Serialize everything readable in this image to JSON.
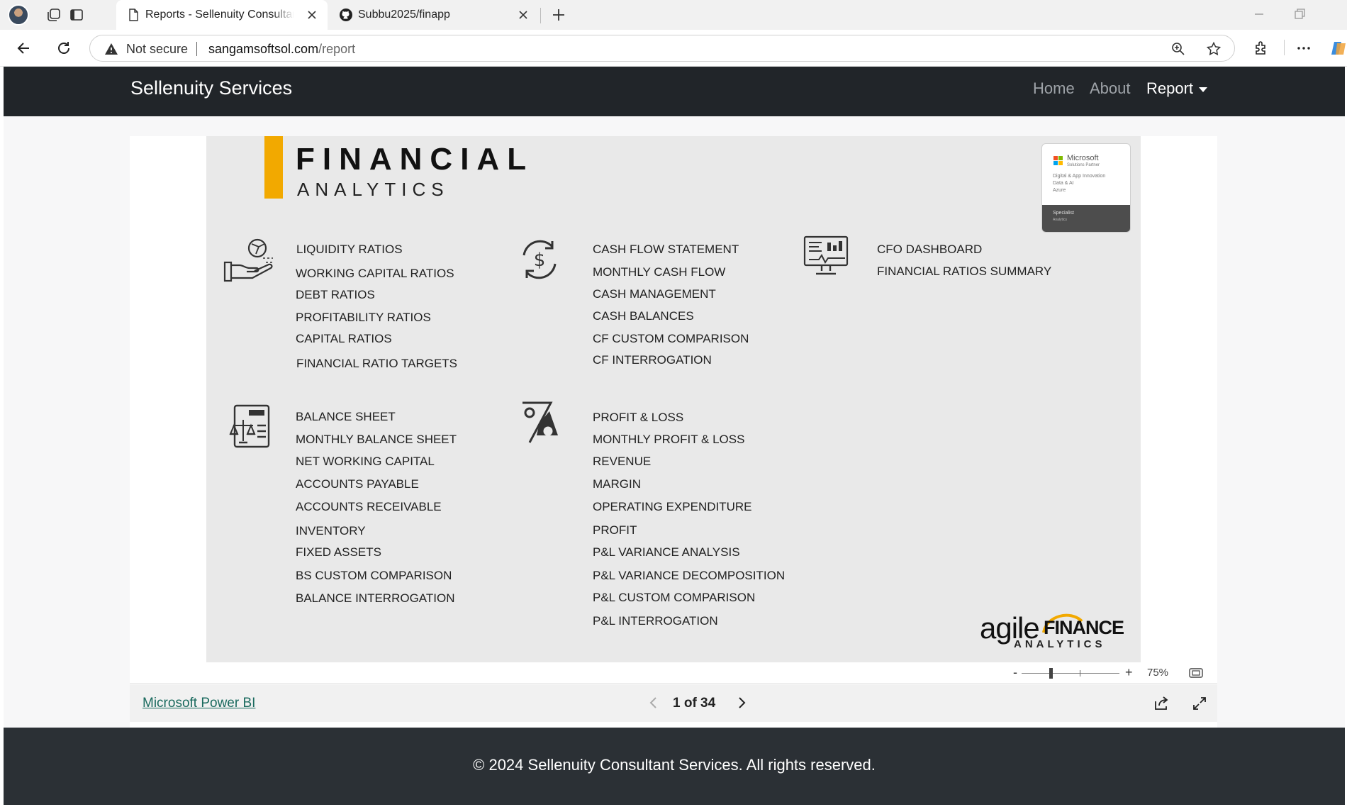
{
  "browser": {
    "tabs": [
      {
        "title": "Reports - Sellenuity Consultant Services",
        "active": true
      },
      {
        "title": "Subbu2025/finapp",
        "active": false
      }
    ],
    "security_label": "Not secure",
    "url_host": "sangamsoftsol.com",
    "url_path": "/report"
  },
  "site": {
    "brand": "Sellenuity Services",
    "nav": {
      "home": "Home",
      "about": "About",
      "report": "Report"
    },
    "footer": "© 2024 Sellenuity Consultant Services. All rights reserved."
  },
  "report": {
    "title": "FINANCIAL",
    "subtitle": "ANALYTICS",
    "badge": {
      "brand": "Microsoft",
      "partner": "Solutions Partner",
      "lines": [
        "Digital & App Innovation",
        "Data & AI",
        "Azure"
      ],
      "specialist": "Specialist",
      "specialist_area": "Analytics"
    },
    "groups": [
      {
        "icon": "hand-coin-icon",
        "items": [
          "LIQUIDITY RATIOS",
          "WORKING CAPITAL RATIOS",
          "DEBT RATIOS",
          "PROFITABILITY RATIOS",
          "CAPITAL RATIOS",
          "FINANCIAL RATIO TARGETS"
        ]
      },
      {
        "icon": "dollar-cycle-icon",
        "items": [
          "CASH FLOW STATEMENT",
          "MONTHLY CASH FLOW",
          "CASH MANAGEMENT",
          "CASH BALANCES",
          "CF CUSTOM COMPARISON",
          "CF INTERROGATION"
        ]
      },
      {
        "icon": "monitor-dashboard-icon",
        "items": [
          "CFO DASHBOARD",
          "FINANCIAL RATIOS SUMMARY"
        ]
      },
      {
        "icon": "balance-scale-doc-icon",
        "items": [
          "BALANCE SHEET",
          "MONTHLY BALANCE SHEET",
          "NET WORKING CAPITAL",
          "ACCOUNTS PAYABLE",
          "ACCOUNTS RECEIVABLE",
          "INVENTORY",
          "FIXED ASSETS",
          "BS CUSTOM COMPARISON",
          "BALANCE INTERROGATION"
        ]
      },
      {
        "icon": "percent-tag-icon",
        "items": [
          "PROFIT & LOSS",
          "MONTHLY PROFIT & LOSS",
          "REVENUE",
          "MARGIN",
          "OPERATING EXPENDITURE",
          "PROFIT",
          "P&L VARIANCE ANALYSIS",
          "P&L VARIANCE DECOMPOSITION",
          "P&L CUSTOM COMPARISON",
          "P&L INTERROGATION"
        ]
      }
    ],
    "partner_logo": {
      "agile": "agile",
      "finance": "FINANCE",
      "analytics": "ANALYTICS"
    }
  },
  "viewer": {
    "zoom_minus": "-",
    "zoom_plus": "+",
    "zoom": "75%",
    "zoom_level": 0.3,
    "powerbi_link": "Microsoft Power BI",
    "page_indicator": "1 of 34"
  },
  "colors": {
    "accent": "#f2a900",
    "navbar": "#212529",
    "footer": "#2b3035",
    "link": "#1a6a5e"
  }
}
